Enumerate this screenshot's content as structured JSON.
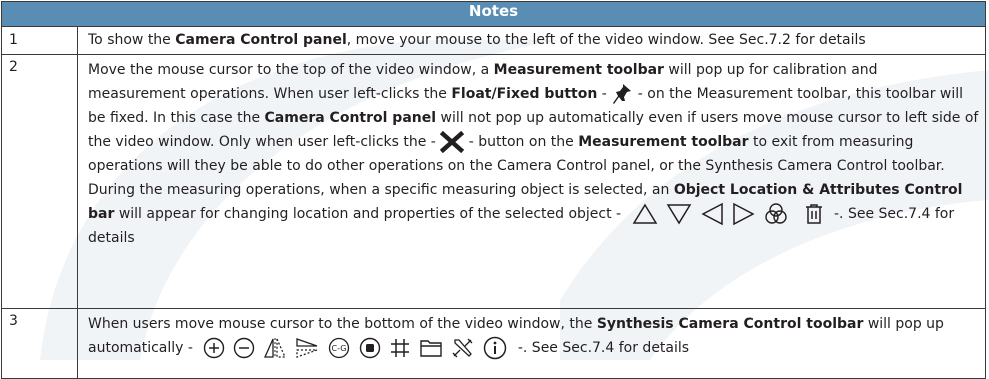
{
  "table": {
    "title": "Notes",
    "rows": [
      {
        "num": "1",
        "text": {
          "p1": "To show the ",
          "b1": "Camera Control panel",
          "p2": ", move your mouse to the left of the video window. See Sec.7.2 for details"
        }
      },
      {
        "num": "2",
        "text": {
          "p1": "Move the mouse cursor to the top of  the video window, a ",
          "b1": "Measurement toolbar",
          "p2": " will pop up for calibration and measurement operations. When user left-clicks the ",
          "b2": "Float/Fixed button",
          "p3": " - ",
          "p4": " - on the Measurement toolbar, this toolbar will be fixed. In this case the ",
          "b3": "Camera Control panel",
          "p5": " will not pop up automatically even if users move mouse cursor to left side of the video window. Only when user left-clicks the - ",
          "p6": " - button on the ",
          "b4": "Measurement toolbar",
          "p7": " to exit from measuring operations will they be able to do other operations on the Camera Control panel, or the Synthesis Camera Control toolbar. During the  measuring operations, when a specific measuring object is selected, an ",
          "b5": "Object Location & Attributes Control bar",
          "p8": "  will appear for changing location and properties of the selected object - ",
          "p9": " -. See Sec.7.4 for details"
        }
      },
      {
        "num": "3",
        "text": {
          "p1": "When users move mouse cursor to the bottom of the video window, the ",
          "b1": "Synthesis Camera Control toolbar",
          "p2": " will pop up automatically - ",
          "p3": " -. See Sec.7.4 for details"
        }
      }
    ]
  },
  "icons": {
    "row2_inline": [
      "pin-icon",
      "close-x-icon"
    ],
    "row2_object_bar": [
      "triangle-up-icon",
      "triangle-down-icon",
      "triangle-left-icon",
      "triangle-right-icon",
      "color-circles-icon",
      "trash-icon"
    ],
    "row3_toolbar": [
      "zoom-in-icon",
      "zoom-out-icon",
      "flip-horizontal-icon",
      "flip-vertical-icon",
      "cg-icon",
      "record-icon",
      "grid-icon",
      "folder-icon",
      "settings-tools-icon",
      "info-icon"
    ]
  },
  "colors": {
    "header_bg": "#5a8db3",
    "header_text": "#ffffff",
    "border": "#3a3a3a",
    "watermark": "#eef2f6"
  }
}
